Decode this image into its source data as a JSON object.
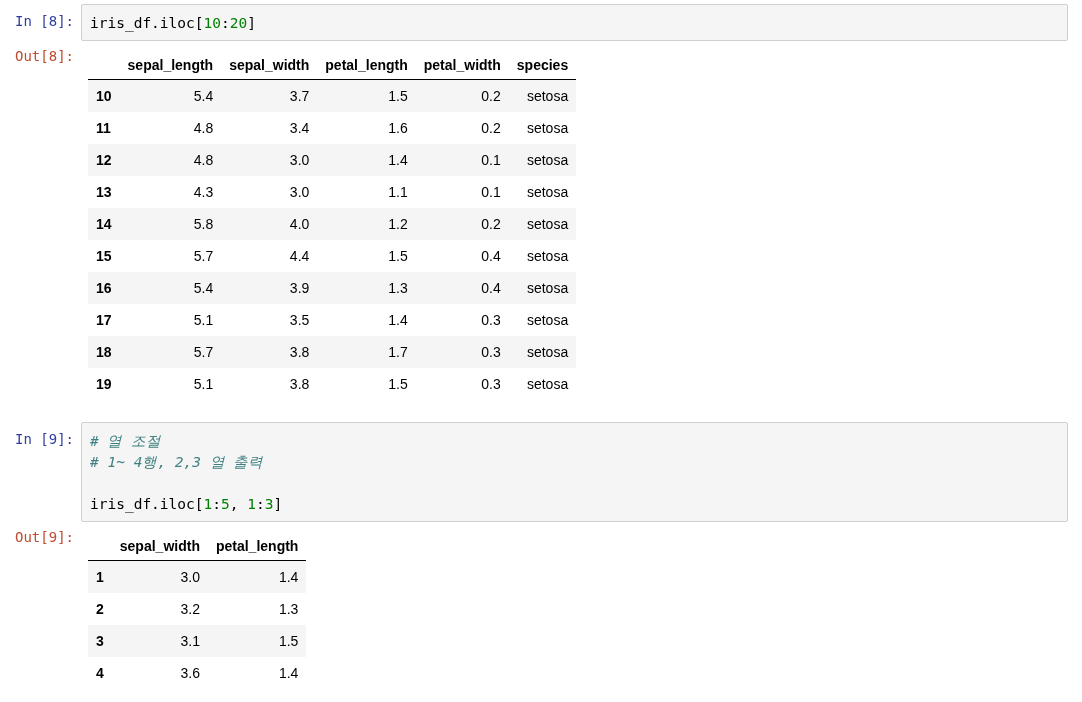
{
  "cells": [
    {
      "input_prompt": "In [8]:",
      "code_lines": [
        {
          "kind": "code",
          "tokens": [
            {
              "text": "iris_df.iloc[",
              "kind": "plain"
            },
            {
              "text": "10",
              "kind": "number"
            },
            {
              "text": ":",
              "kind": "plain"
            },
            {
              "text": "20",
              "kind": "number"
            },
            {
              "text": "]",
              "kind": "plain"
            }
          ]
        }
      ],
      "output_prompt": "Out[8]:",
      "table": {
        "columns": [
          "sepal_length",
          "sepal_width",
          "petal_length",
          "petal_width",
          "species"
        ],
        "rows": [
          {
            "index": "10",
            "cells": [
              "5.4",
              "3.7",
              "1.5",
              "0.2",
              "setosa"
            ]
          },
          {
            "index": "11",
            "cells": [
              "4.8",
              "3.4",
              "1.6",
              "0.2",
              "setosa"
            ]
          },
          {
            "index": "12",
            "cells": [
              "4.8",
              "3.0",
              "1.4",
              "0.1",
              "setosa"
            ]
          },
          {
            "index": "13",
            "cells": [
              "4.3",
              "3.0",
              "1.1",
              "0.1",
              "setosa"
            ]
          },
          {
            "index": "14",
            "cells": [
              "5.8",
              "4.0",
              "1.2",
              "0.2",
              "setosa"
            ]
          },
          {
            "index": "15",
            "cells": [
              "5.7",
              "4.4",
              "1.5",
              "0.4",
              "setosa"
            ]
          },
          {
            "index": "16",
            "cells": [
              "5.4",
              "3.9",
              "1.3",
              "0.4",
              "setosa"
            ]
          },
          {
            "index": "17",
            "cells": [
              "5.1",
              "3.5",
              "1.4",
              "0.3",
              "setosa"
            ]
          },
          {
            "index": "18",
            "cells": [
              "5.7",
              "3.8",
              "1.7",
              "0.3",
              "setosa"
            ]
          },
          {
            "index": "19",
            "cells": [
              "5.1",
              "3.8",
              "1.5",
              "0.3",
              "setosa"
            ]
          }
        ]
      }
    },
    {
      "input_prompt": "In [9]:",
      "code_lines": [
        {
          "kind": "comment",
          "text": "# 열 조절"
        },
        {
          "kind": "comment",
          "text": "# 1~ 4행, 2,3 열 출력"
        },
        {
          "kind": "blank"
        },
        {
          "kind": "code",
          "tokens": [
            {
              "text": "iris_df.iloc[",
              "kind": "plain"
            },
            {
              "text": "1",
              "kind": "number"
            },
            {
              "text": ":",
              "kind": "plain"
            },
            {
              "text": "5",
              "kind": "number"
            },
            {
              "text": ", ",
              "kind": "plain"
            },
            {
              "text": "1",
              "kind": "number"
            },
            {
              "text": ":",
              "kind": "plain"
            },
            {
              "text": "3",
              "kind": "number"
            },
            {
              "text": "]",
              "kind": "plain"
            }
          ]
        }
      ],
      "output_prompt": "Out[9]:",
      "table": {
        "columns": [
          "sepal_width",
          "petal_length"
        ],
        "rows": [
          {
            "index": "1",
            "cells": [
              "3.0",
              "1.4"
            ]
          },
          {
            "index": "2",
            "cells": [
              "3.2",
              "1.3"
            ]
          },
          {
            "index": "3",
            "cells": [
              "3.1",
              "1.5"
            ]
          },
          {
            "index": "4",
            "cells": [
              "3.6",
              "1.4"
            ]
          }
        ]
      }
    }
  ]
}
